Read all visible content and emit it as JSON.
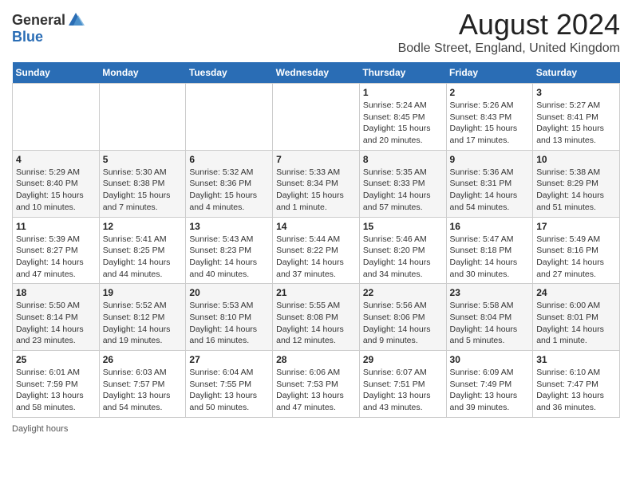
{
  "header": {
    "logo_general": "General",
    "logo_blue": "Blue",
    "month_year": "August 2024",
    "location": "Bodle Street, England, United Kingdom"
  },
  "weekdays": [
    "Sunday",
    "Monday",
    "Tuesday",
    "Wednesday",
    "Thursday",
    "Friday",
    "Saturday"
  ],
  "weeks": [
    [
      {
        "day": "",
        "info": ""
      },
      {
        "day": "",
        "info": ""
      },
      {
        "day": "",
        "info": ""
      },
      {
        "day": "",
        "info": ""
      },
      {
        "day": "1",
        "info": "Sunrise: 5:24 AM\nSunset: 8:45 PM\nDaylight: 15 hours and 20 minutes."
      },
      {
        "day": "2",
        "info": "Sunrise: 5:26 AM\nSunset: 8:43 PM\nDaylight: 15 hours and 17 minutes."
      },
      {
        "day": "3",
        "info": "Sunrise: 5:27 AM\nSunset: 8:41 PM\nDaylight: 15 hours and 13 minutes."
      }
    ],
    [
      {
        "day": "4",
        "info": "Sunrise: 5:29 AM\nSunset: 8:40 PM\nDaylight: 15 hours and 10 minutes."
      },
      {
        "day": "5",
        "info": "Sunrise: 5:30 AM\nSunset: 8:38 PM\nDaylight: 15 hours and 7 minutes."
      },
      {
        "day": "6",
        "info": "Sunrise: 5:32 AM\nSunset: 8:36 PM\nDaylight: 15 hours and 4 minutes."
      },
      {
        "day": "7",
        "info": "Sunrise: 5:33 AM\nSunset: 8:34 PM\nDaylight: 15 hours and 1 minute."
      },
      {
        "day": "8",
        "info": "Sunrise: 5:35 AM\nSunset: 8:33 PM\nDaylight: 14 hours and 57 minutes."
      },
      {
        "day": "9",
        "info": "Sunrise: 5:36 AM\nSunset: 8:31 PM\nDaylight: 14 hours and 54 minutes."
      },
      {
        "day": "10",
        "info": "Sunrise: 5:38 AM\nSunset: 8:29 PM\nDaylight: 14 hours and 51 minutes."
      }
    ],
    [
      {
        "day": "11",
        "info": "Sunrise: 5:39 AM\nSunset: 8:27 PM\nDaylight: 14 hours and 47 minutes."
      },
      {
        "day": "12",
        "info": "Sunrise: 5:41 AM\nSunset: 8:25 PM\nDaylight: 14 hours and 44 minutes."
      },
      {
        "day": "13",
        "info": "Sunrise: 5:43 AM\nSunset: 8:23 PM\nDaylight: 14 hours and 40 minutes."
      },
      {
        "day": "14",
        "info": "Sunrise: 5:44 AM\nSunset: 8:22 PM\nDaylight: 14 hours and 37 minutes."
      },
      {
        "day": "15",
        "info": "Sunrise: 5:46 AM\nSunset: 8:20 PM\nDaylight: 14 hours and 34 minutes."
      },
      {
        "day": "16",
        "info": "Sunrise: 5:47 AM\nSunset: 8:18 PM\nDaylight: 14 hours and 30 minutes."
      },
      {
        "day": "17",
        "info": "Sunrise: 5:49 AM\nSunset: 8:16 PM\nDaylight: 14 hours and 27 minutes."
      }
    ],
    [
      {
        "day": "18",
        "info": "Sunrise: 5:50 AM\nSunset: 8:14 PM\nDaylight: 14 hours and 23 minutes."
      },
      {
        "day": "19",
        "info": "Sunrise: 5:52 AM\nSunset: 8:12 PM\nDaylight: 14 hours and 19 minutes."
      },
      {
        "day": "20",
        "info": "Sunrise: 5:53 AM\nSunset: 8:10 PM\nDaylight: 14 hours and 16 minutes."
      },
      {
        "day": "21",
        "info": "Sunrise: 5:55 AM\nSunset: 8:08 PM\nDaylight: 14 hours and 12 minutes."
      },
      {
        "day": "22",
        "info": "Sunrise: 5:56 AM\nSunset: 8:06 PM\nDaylight: 14 hours and 9 minutes."
      },
      {
        "day": "23",
        "info": "Sunrise: 5:58 AM\nSunset: 8:04 PM\nDaylight: 14 hours and 5 minutes."
      },
      {
        "day": "24",
        "info": "Sunrise: 6:00 AM\nSunset: 8:01 PM\nDaylight: 14 hours and 1 minute."
      }
    ],
    [
      {
        "day": "25",
        "info": "Sunrise: 6:01 AM\nSunset: 7:59 PM\nDaylight: 13 hours and 58 minutes."
      },
      {
        "day": "26",
        "info": "Sunrise: 6:03 AM\nSunset: 7:57 PM\nDaylight: 13 hours and 54 minutes."
      },
      {
        "day": "27",
        "info": "Sunrise: 6:04 AM\nSunset: 7:55 PM\nDaylight: 13 hours and 50 minutes."
      },
      {
        "day": "28",
        "info": "Sunrise: 6:06 AM\nSunset: 7:53 PM\nDaylight: 13 hours and 47 minutes."
      },
      {
        "day": "29",
        "info": "Sunrise: 6:07 AM\nSunset: 7:51 PM\nDaylight: 13 hours and 43 minutes."
      },
      {
        "day": "30",
        "info": "Sunrise: 6:09 AM\nSunset: 7:49 PM\nDaylight: 13 hours and 39 minutes."
      },
      {
        "day": "31",
        "info": "Sunrise: 6:10 AM\nSunset: 7:47 PM\nDaylight: 13 hours and 36 minutes."
      }
    ]
  ],
  "footer": {
    "daylight_label": "Daylight hours"
  }
}
